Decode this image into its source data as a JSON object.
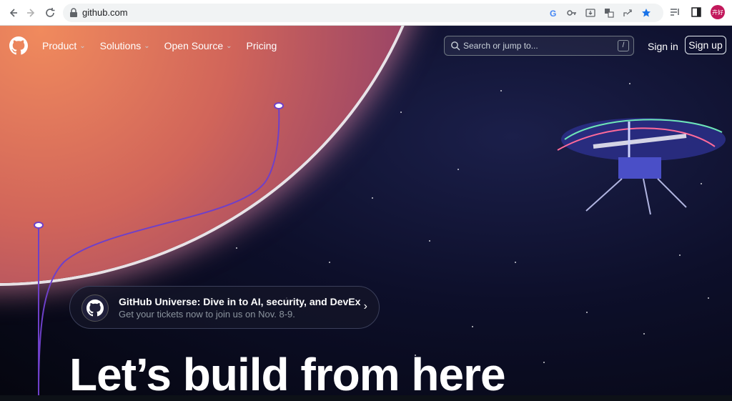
{
  "browser": {
    "url": "github.com",
    "avatar_text": "卉好"
  },
  "header": {
    "nav": [
      {
        "label": "Product",
        "has_menu": true
      },
      {
        "label": "Solutions",
        "has_menu": true
      },
      {
        "label": "Open Source",
        "has_menu": true
      },
      {
        "label": "Pricing",
        "has_menu": false
      }
    ],
    "search_placeholder": "Search or jump to...",
    "search_shortcut": "/",
    "sign_in": "Sign in",
    "sign_up": "Sign up"
  },
  "banner": {
    "title": "GitHub Universe: Dive in to AI, security, and DevEx",
    "subtitle": "Get your tickets now to join us on Nov. 8-9."
  },
  "hero": {
    "headline": "Let’s build from here"
  },
  "colors": {
    "accent": "#7c5cff",
    "background": "#0d1117"
  }
}
